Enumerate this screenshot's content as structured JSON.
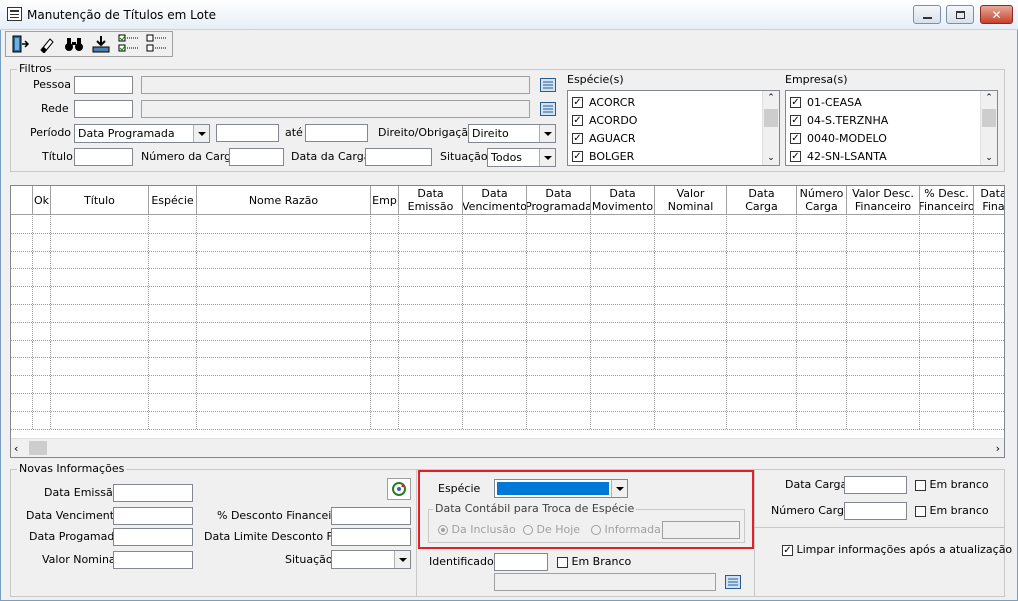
{
  "window": {
    "title": "Manutenção de Títulos em Lote",
    "controls": {
      "minimize": "▬",
      "maximize": "□",
      "close": "✕"
    }
  },
  "toolbar": {
    "buttons": [
      {
        "name": "exit-door-icon"
      },
      {
        "name": "eraser-icon"
      },
      {
        "name": "binoculars-icon"
      },
      {
        "name": "save-tray-icon"
      },
      {
        "name": "check-all-icon"
      },
      {
        "name": "uncheck-all-icon"
      }
    ]
  },
  "filters": {
    "title": "Filtros",
    "pessoa_label": "Pessoa",
    "rede_label": "Rede",
    "periodo_label": "Período",
    "periodo_value": "Data Programada",
    "ate_label": "até",
    "direito_label": "Direito/Obrigação",
    "direito_value": "Direito",
    "titulo_label": "Título",
    "numero_carga_label": "Número da Carga",
    "data_carga_label": "Data da Carga",
    "situacao_label": "Situação",
    "situacao_value": "Todos",
    "especies_label": "Espécie(s)",
    "especies": [
      "ACORCR",
      "ACORDO",
      "AGUACR",
      "BOLGER"
    ],
    "empresas_label": "Empresa(s)",
    "empresas": [
      "01-CEASA",
      "04-S.TERZNHA",
      "0040-MODELO",
      "42-SN-LSANTA"
    ]
  },
  "grid": {
    "columns": [
      "Ok",
      "Título",
      "Espécie",
      "Nome Razão",
      "Emp",
      "Data\nEmissão",
      "Data\nVencimento",
      "Data\nProgramada",
      "Data\nMovimento",
      "Valor\nNominal",
      "Data\nCarga",
      "Número\nCarga",
      "Valor Desc.\nFinanceiro",
      "% Desc.\nFinanceiro",
      "Data\nFina"
    ]
  },
  "novas": {
    "title": "Novas Informações",
    "data_emissao_label": "Data Emissão",
    "data_vencimento_label": "Data Vencimento",
    "data_programada_label": "Data Progamada",
    "valor_nominal_label": "Valor Nominal",
    "desconto_label": "% Desconto Financeiro",
    "data_limite_label": "Data Limite Desconto Fin.",
    "situacao_label": "Situação"
  },
  "especie_box": {
    "especie_label": "Espécie",
    "group_title": "Data Contábil para Troca de Espécie",
    "radio_inclusao": "Da Inclusão",
    "radio_hoje": "De Hoje",
    "radio_informada": "Informada"
  },
  "identificador": {
    "label": "Identificador",
    "em_branco": "Em Branco"
  },
  "right_panel": {
    "data_carga_label": "Data Carga",
    "numero_carga_label": "Número Carga",
    "em_branco_1": "Em branco",
    "em_branco_2": "Em branco",
    "limpar_label": "Limpar informações após a atualização"
  },
  "colors": {
    "highlight_border": "#e0202a",
    "combo_selected": "#0078d7"
  }
}
